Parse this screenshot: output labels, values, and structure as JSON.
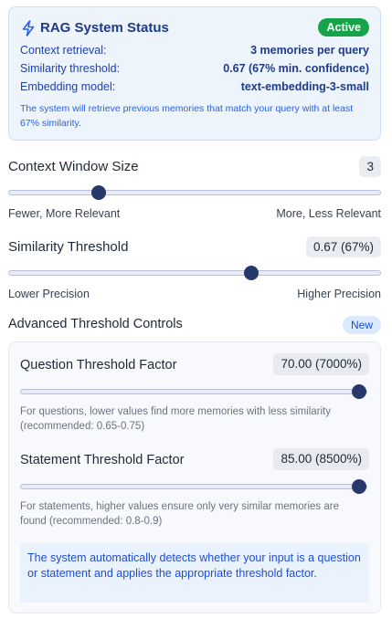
{
  "status": {
    "title": "RAG System Status",
    "badge": "Active",
    "rows": [
      {
        "label": "Context retrieval:",
        "value": "3 memories per query"
      },
      {
        "label": "Similarity threshold:",
        "value": "0.67 (67% min. confidence)"
      },
      {
        "label": "Embedding model:",
        "value": "text-embedding-3-small"
      }
    ],
    "note": "The system will retrieve previous memories that match your query with at least 67% similarity."
  },
  "context_window": {
    "label": "Context Window Size",
    "value": "3",
    "level": 0.23,
    "min_caption": "Fewer, More Relevant",
    "max_caption": "More, Less Relevant"
  },
  "similarity": {
    "label": "Similarity Threshold",
    "value": "0.67 (67%)",
    "level": 0.66,
    "min_caption": "Lower Precision",
    "max_caption": "Higher Precision"
  },
  "advanced": {
    "label": "Advanced Threshold Controls",
    "badge": "New",
    "question": {
      "label": "Question Threshold Factor",
      "value": "70.00 (7000%)",
      "level": 1.0,
      "help": "For questions, lower values find more memories with less similarity (recommended: 0.65-0.75)"
    },
    "statement": {
      "label": "Statement Threshold Factor",
      "value": "85.00 (8500%)",
      "level": 1.0,
      "help": "For statements, higher values ensure only very similar memories are found (recommended: 0.8-0.9)"
    },
    "info": "The system automatically detects whether your input is a question or statement and applies the appropriate threshold factor."
  },
  "colors": {
    "accent": "#1e3a8a",
    "active_badge": "#16a34a",
    "slider_thumb": "#27396a"
  }
}
